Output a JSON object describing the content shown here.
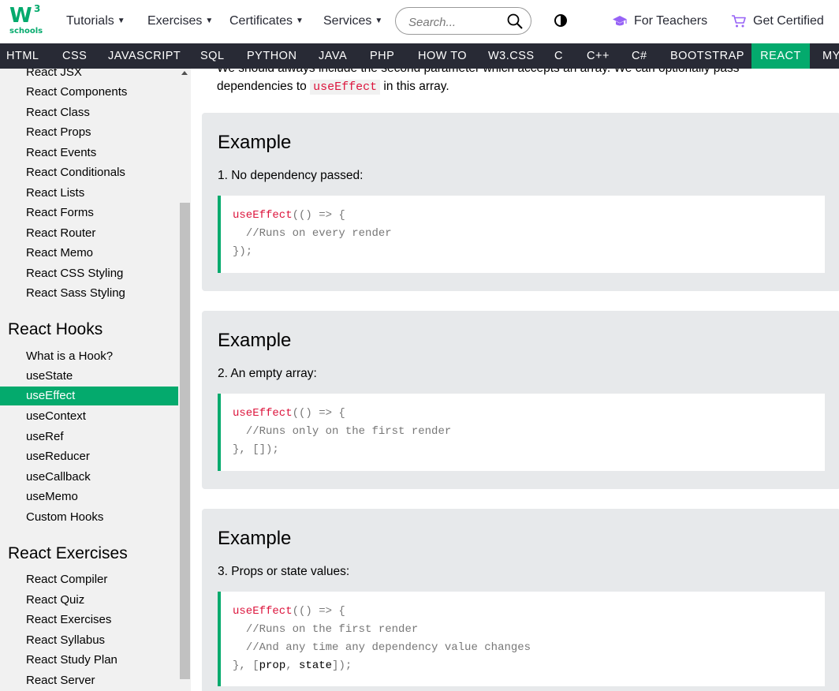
{
  "header": {
    "logo_main": "W",
    "logo_sup": "3",
    "logo_sub": "schools",
    "menus": [
      {
        "label": "Tutorials"
      },
      {
        "label": "Exercises"
      },
      {
        "label": "Certificates"
      },
      {
        "label": "Services"
      }
    ],
    "search_placeholder": "Search...",
    "for_teachers": "For Teachers",
    "get_certified": "Get Certified"
  },
  "nav": [
    "HTML",
    "CSS",
    "JAVASCRIPT",
    "SQL",
    "PYTHON",
    "JAVA",
    "PHP",
    "HOW TO",
    "W3.CSS",
    "C",
    "C++",
    "C#",
    "BOOTSTRAP",
    "REACT",
    "MY"
  ],
  "nav_active": "REACT",
  "sidebar": {
    "links_top": [
      "React JSX",
      "React Components",
      "React Class",
      "React Props",
      "React Events",
      "React Conditionals",
      "React Lists",
      "React Forms",
      "React Router",
      "React Memo",
      "React CSS Styling",
      "React Sass Styling"
    ],
    "heading_hooks": "React Hooks",
    "hooks": [
      "What is a Hook?",
      "useState",
      "useEffect",
      "useContext",
      "useRef",
      "useReducer",
      "useCallback",
      "useMemo",
      "Custom Hooks"
    ],
    "active_hook": "useEffect",
    "heading_exercises": "React Exercises",
    "exercises": [
      "React Compiler",
      "React Quiz",
      "React Exercises",
      "React Syllabus",
      "React Study Plan",
      "React Server"
    ]
  },
  "main": {
    "intro_line1": "We should always include the second parameter which accepts an array. We can optionally pass",
    "intro_line2_pre": "dependencies to ",
    "intro_code": "useEffect",
    "intro_line2_post": " in this array.",
    "examples": [
      {
        "title": "Example",
        "desc": "1. No dependency passed:",
        "code_fn": "useEffect",
        "code_open": "(() => {",
        "comments": [
          "//Runs on every render"
        ],
        "code_close": "});"
      },
      {
        "title": "Example",
        "desc": "2. An empty array:",
        "code_fn": "useEffect",
        "code_open": "(() => {",
        "comments": [
          "//Runs only on the first render"
        ],
        "code_close": "}, []);"
      },
      {
        "title": "Example",
        "desc": "3. Props or state values:",
        "code_fn": "useEffect",
        "code_open": "(() => {",
        "comments": [
          "//Runs on the first render",
          "//And any time any dependency value changes"
        ],
        "code_close_pre": "}, [",
        "code_close_a": "prop",
        "code_close_sep": ", ",
        "code_close_b": "state",
        "code_close_post": "]);"
      }
    ]
  },
  "colors": {
    "brand": "#04aa6d",
    "nav_bg": "#282a35",
    "sidebar_bg": "#f1f1f1",
    "example_bg": "#e7e9eb",
    "code_keyword": "#dc143c"
  }
}
